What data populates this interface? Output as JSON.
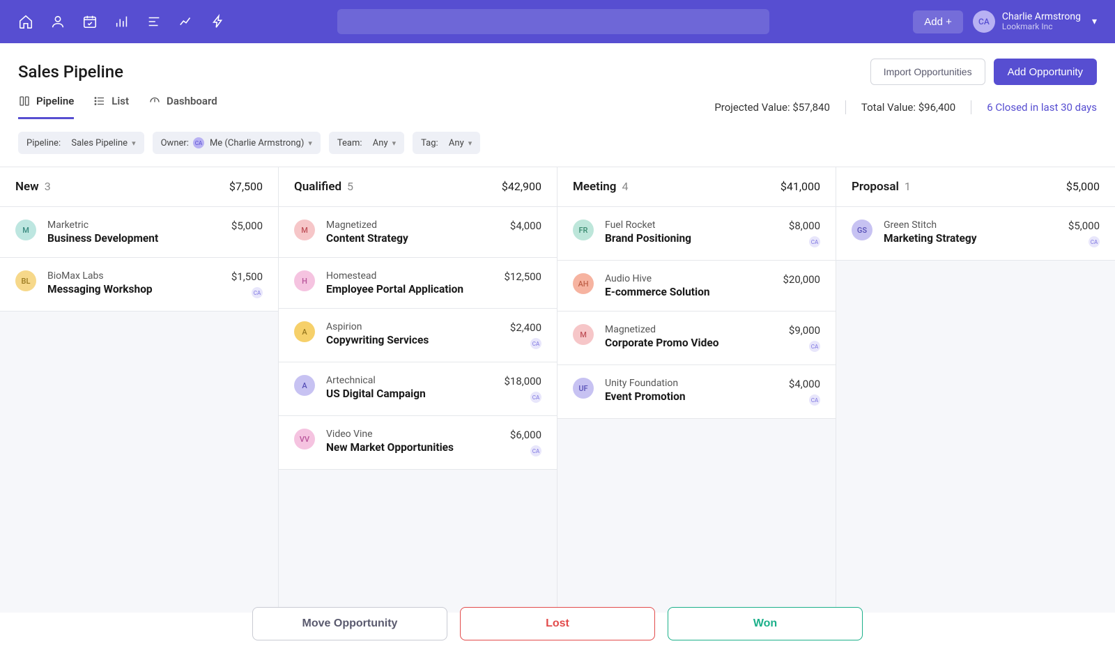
{
  "topbar": {
    "add_label": "Add +",
    "user_initials": "CA",
    "user_name": "Charlie Armstrong",
    "user_org": "Lookmark Inc"
  },
  "header": {
    "title": "Sales Pipeline",
    "import_label": "Import Opportunities",
    "add_label": "Add Opportunity"
  },
  "tabs": {
    "pipeline": "Pipeline",
    "list": "List",
    "dashboard": "Dashboard"
  },
  "stats": {
    "projected_label": "Projected Value: ",
    "projected_value": "$57,840",
    "total_label": "Total Value: ",
    "total_value": "$96,400",
    "closed_text": "6 Closed in last 30 days"
  },
  "filters": {
    "pipeline_label": "Pipeline:",
    "pipeline_value": "Sales Pipeline",
    "owner_label": "Owner:",
    "owner_value": "Me (Charlie Armstrong)",
    "owner_initials": "CA",
    "team_label": "Team:",
    "team_value": "Any",
    "tag_label": "Tag:",
    "tag_value": "Any"
  },
  "columns": [
    {
      "title": "New",
      "count": "3",
      "total": "$7,500",
      "cards": [
        {
          "company": "Marketric",
          "title": "Business Development",
          "value": "$5,000",
          "initials": "M",
          "bg": "#BDE6E0",
          "fg": "#3a8b80",
          "owner": ""
        },
        {
          "company": "BioMax Labs",
          "title": "Messaging Workshop",
          "value": "$1,500",
          "initials": "BL",
          "bg": "#F6D88A",
          "fg": "#9a7a20",
          "owner": "CA"
        }
      ]
    },
    {
      "title": "Qualified",
      "count": "5",
      "total": "$42,900",
      "cards": [
        {
          "company": "Magnetized",
          "title": "Content Strategy",
          "value": "$4,000",
          "initials": "M",
          "bg": "#F6C6C8",
          "fg": "#c0525a",
          "owner": ""
        },
        {
          "company": "Homestead",
          "title": "Employee Portal Application",
          "value": "$12,500",
          "initials": "H",
          "bg": "#F5C3E0",
          "fg": "#b8549a",
          "owner": ""
        },
        {
          "company": "Aspirion",
          "title": "Copywriting Services",
          "value": "$2,400",
          "initials": "A",
          "bg": "#F6D06A",
          "fg": "#9a7a20",
          "owner": "CA"
        },
        {
          "company": "Artechnical",
          "title": "US Digital Campaign",
          "value": "$18,000",
          "initials": "A",
          "bg": "#C7C2F2",
          "fg": "#5a52b8",
          "owner": "CA"
        },
        {
          "company": "Video Vine",
          "title": "New Market Opportunities",
          "value": "$6,000",
          "initials": "VV",
          "bg": "#F5C3E0",
          "fg": "#b8549a",
          "owner": "CA"
        }
      ]
    },
    {
      "title": "Meeting",
      "count": "4",
      "total": "$41,000",
      "cards": [
        {
          "company": "Fuel Rocket",
          "title": "Brand Positioning",
          "value": "$8,000",
          "initials": "FR",
          "bg": "#BDE6DA",
          "fg": "#3a8b70",
          "owner": "CA"
        },
        {
          "company": "Audio Hive",
          "title": "E-commerce Solution",
          "value": "$20,000",
          "initials": "AH",
          "bg": "#F6B3A0",
          "fg": "#c0624a",
          "owner": ""
        },
        {
          "company": "Magnetized",
          "title": "Corporate Promo Video",
          "value": "$9,000",
          "initials": "M",
          "bg": "#F6C6C8",
          "fg": "#c0525a",
          "owner": "CA"
        },
        {
          "company": "Unity Foundation",
          "title": "Event Promotion",
          "value": "$4,000",
          "initials": "UF",
          "bg": "#C7C2F2",
          "fg": "#5a52b8",
          "owner": "CA"
        }
      ]
    },
    {
      "title": "Proposal",
      "count": "1",
      "total": "$5,000",
      "cards": [
        {
          "company": "Green Stitch",
          "title": "Marketing Strategy",
          "value": "$5,000",
          "initials": "GS",
          "bg": "#C7C2F2",
          "fg": "#5a52b8",
          "owner": "CA"
        }
      ]
    }
  ],
  "bottom": {
    "move": "Move Opportunity",
    "lost": "Lost",
    "won": "Won"
  }
}
